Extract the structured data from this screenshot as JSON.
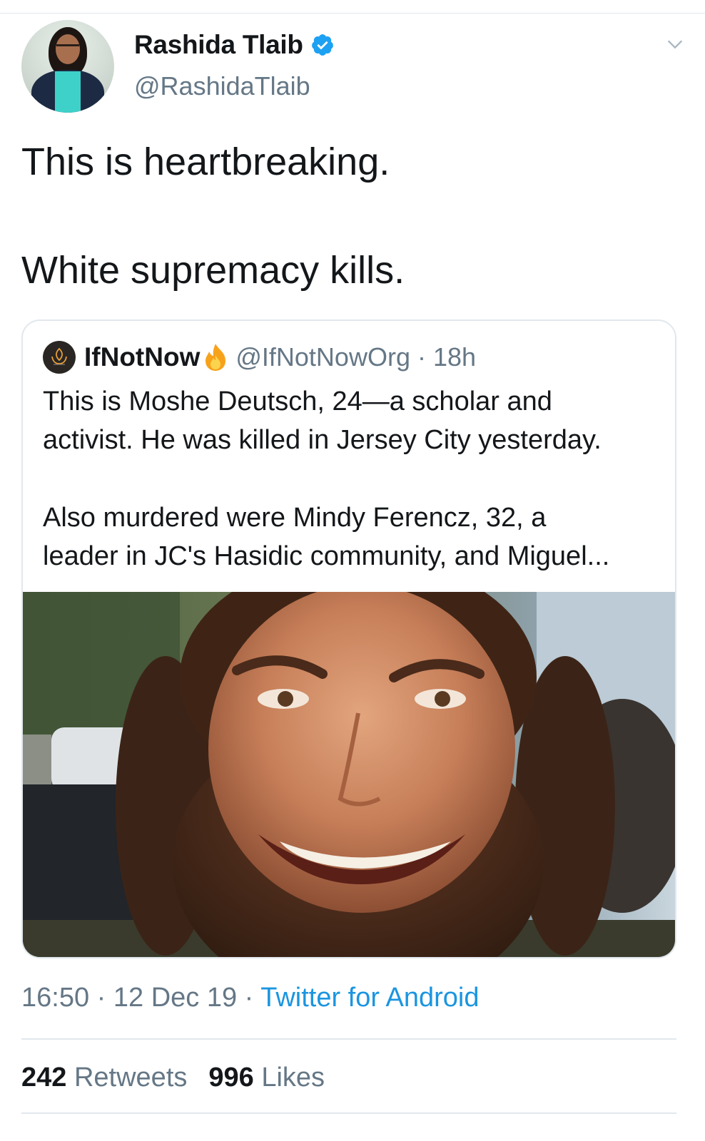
{
  "tweet": {
    "author_name": "Rashida Tlaib",
    "author_handle": "@RashidaTlaib",
    "verified": true,
    "text_line_1": "This is heartbreaking.",
    "text_line_2": "White supremacy kills.",
    "time": "16:50",
    "separator": "·",
    "date": "12 Dec 19",
    "source": "Twitter for Android",
    "retweets_count": "242",
    "retweets_label": "Retweets",
    "likes_count": "996",
    "likes_label": "Likes"
  },
  "quoted_tweet": {
    "author_name": "IfNotNow",
    "author_handle": "@IfNotNowOrg",
    "separator": "·",
    "age": "18h",
    "line_1": "This is Moshe Deutsch, 24—a scholar and",
    "line_2": "activist. He was killed in Jersey City yesterday.",
    "line_3": "Also murdered were Mindy Ferencz, 32, a",
    "line_4": "leader in JC's Hasidic community, and Miguel..."
  },
  "icons": {
    "verified": "verified-badge-icon",
    "caret": "chevron-down-icon",
    "flame": "flame-icon",
    "logo": "ifnotnow-logo"
  },
  "colors": {
    "text": "#14171a",
    "secondary": "#657786",
    "link": "#1b95e0",
    "verified": "#1da1f2",
    "border": "#e1e8ed"
  }
}
